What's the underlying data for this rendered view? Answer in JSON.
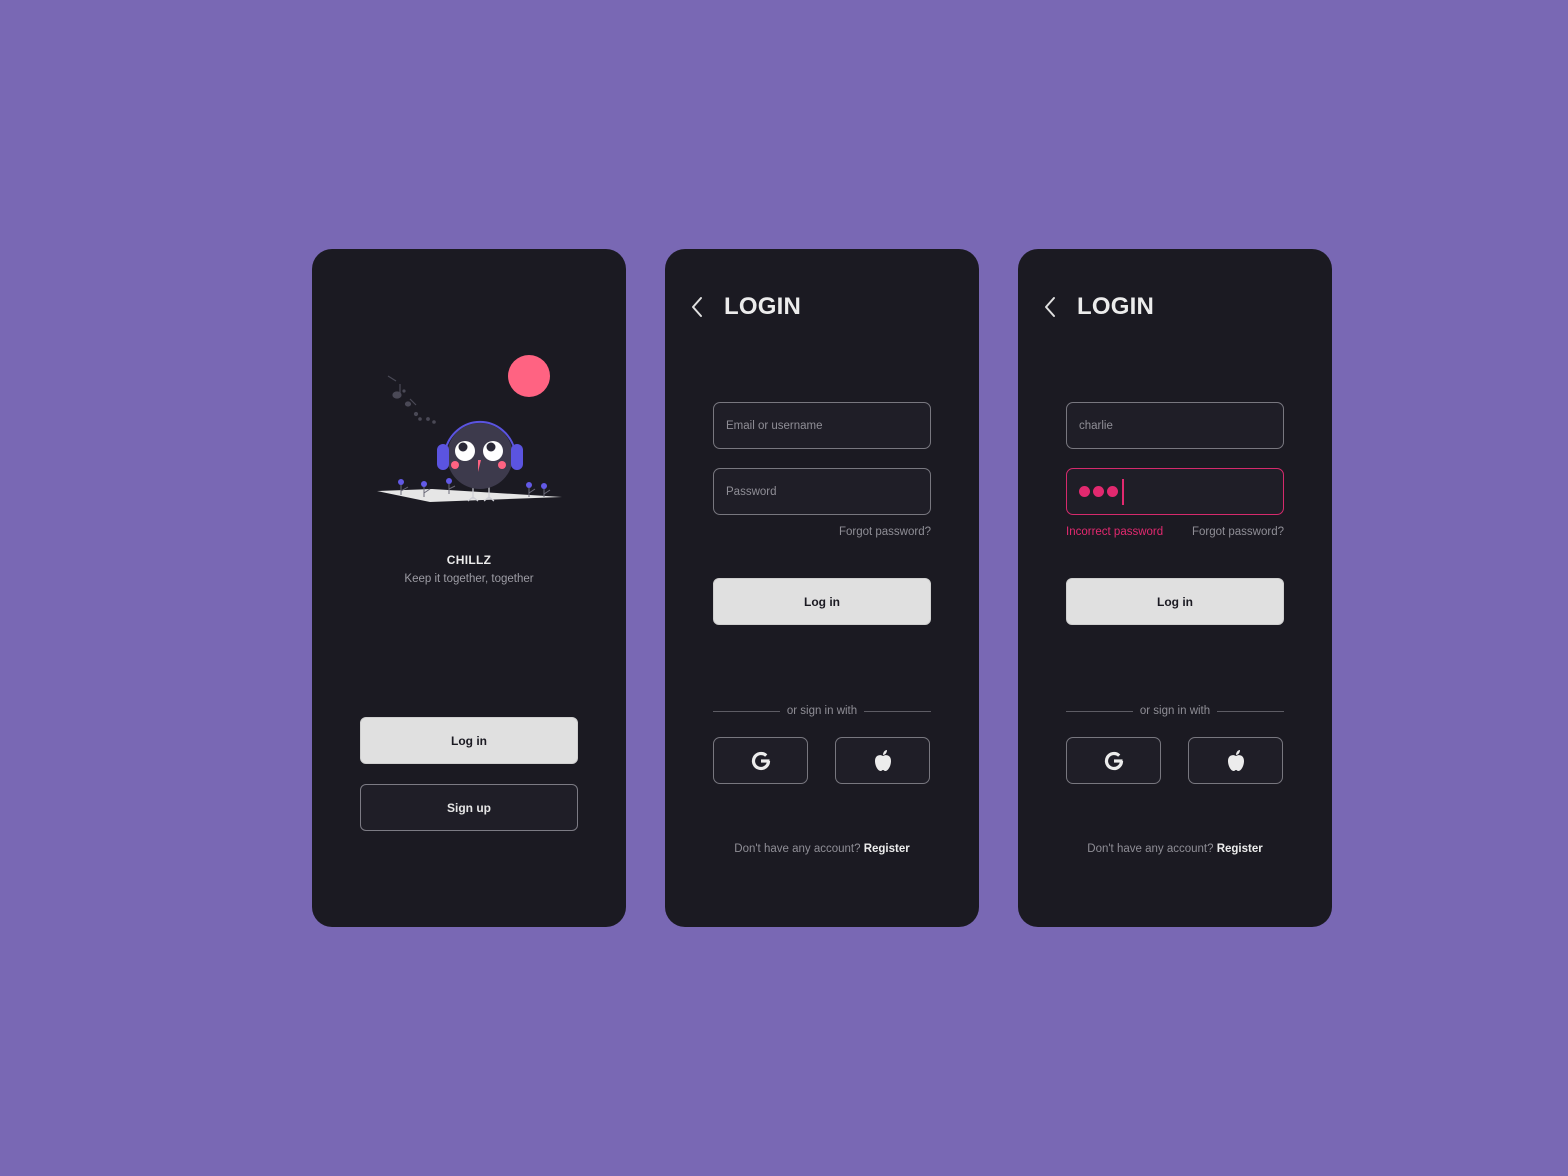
{
  "welcome": {
    "brand_name": "CHILLZ",
    "tagline": "Keep it together, together",
    "login_label": "Log in",
    "signup_label": "Sign up",
    "illustration": "bird-with-headphones-illustration"
  },
  "login": {
    "title": "LOGIN",
    "back_icon": "chevron-left-icon",
    "username_placeholder": "Email or username",
    "password_placeholder": "Password",
    "forgot_label": "Forgot password?",
    "login_label": "Log in",
    "divider_text": "or sign in with",
    "social": [
      {
        "name": "google",
        "icon": "google-icon"
      },
      {
        "name": "apple",
        "icon": "apple-icon"
      }
    ],
    "no_account_text": "Don't have any account?",
    "register_label": "Register"
  },
  "login_error": {
    "title": "LOGIN",
    "back_icon": "chevron-left-icon",
    "username_value": "charlie",
    "password_masked_length": 3,
    "error_message": "Incorrect password",
    "forgot_label": "Forgot password?",
    "login_label": "Log in",
    "divider_text": "or sign in with",
    "no_account_text": "Don't have any account?",
    "register_label": "Register"
  },
  "colors": {
    "background": "#7968b4",
    "screen": "#1b1a22",
    "accent_error": "#e2296f",
    "sun": "#ff6382",
    "headphones": "#5b54e0",
    "primary_button": "#e0e0e0"
  }
}
